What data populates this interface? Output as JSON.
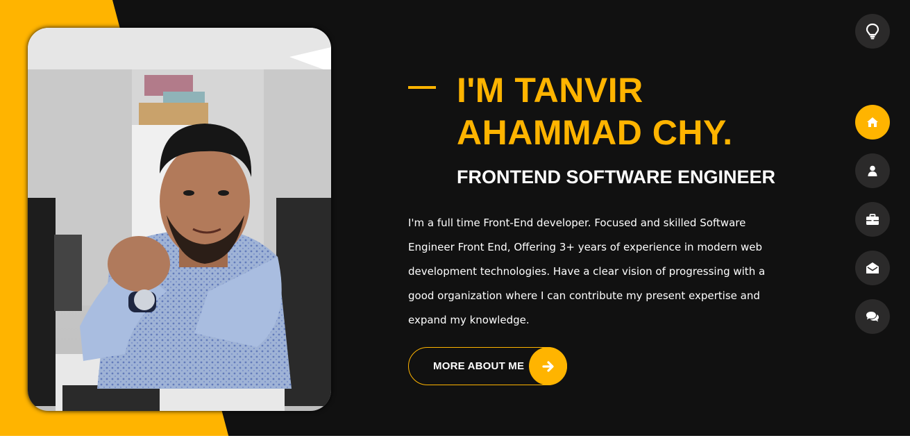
{
  "profile": {
    "name_line1": "I'M TANVIR",
    "name_line2": "AHAMMAD CHY.",
    "role": "FRONTEND SOFTWARE ENGINEER",
    "bio": "I'm a full time Front-End developer. Focused and skilled Software Engineer Front End, Offering 3+ years of experience in modern web development technologies. Have a clear vision of progressing with a good organization where I can contribute my present expertise and expand my knowledge."
  },
  "cta": {
    "label": "MORE ABOUT ME",
    "icon": "arrow-right-icon"
  },
  "theme_toggle": {
    "icon": "lightbulb-icon"
  },
  "nav": [
    {
      "id": "home",
      "icon": "home-icon",
      "active": true
    },
    {
      "id": "about",
      "icon": "user-icon",
      "active": false
    },
    {
      "id": "portfolio",
      "icon": "briefcase-icon",
      "active": false
    },
    {
      "id": "contact",
      "icon": "envelope-open-icon",
      "active": false
    },
    {
      "id": "blog",
      "icon": "comments-icon",
      "active": false
    }
  ],
  "colors": {
    "accent": "#ffb400",
    "background": "#111111",
    "nav_bg": "#2b2a2a",
    "text": "#ffffff"
  }
}
